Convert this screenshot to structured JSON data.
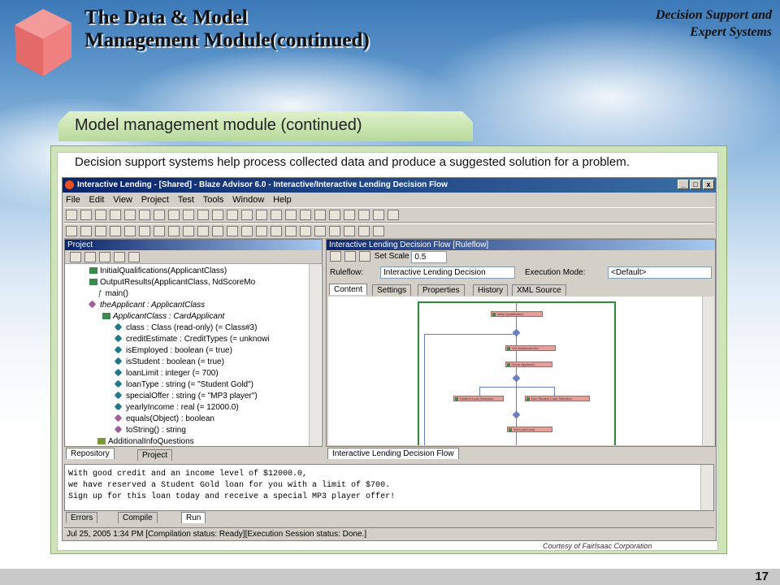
{
  "slide": {
    "title_line1": "The Data & Model",
    "title_line2": "Management Module(continued)",
    "brand_line1": "Decision Support and",
    "brand_line2": "Expert Systems",
    "ribbon_label": "Model management module (continued)",
    "caption": "Decision support systems help process collected data and produce a suggested solution for a problem.",
    "courtesy": "Courtesy of Fairlsaac Corporation",
    "page_number": "17"
  },
  "app": {
    "window_title": "Interactive Lending - [Shared] - Blaze Advisor 6.0 - Interactive/Interactive Lending Decision Flow",
    "window_controls": [
      "_",
      "□",
      "x"
    ],
    "menu": [
      "File",
      "Edit",
      "View",
      "Project",
      "Test",
      "Tools",
      "Window",
      "Help"
    ],
    "project_panel": {
      "header": "Project",
      "items": [
        "InitialQualifications(ApplicantClass)",
        "OutputResults(ApplicantClass, NdScoreMo",
        "main()",
        "theApplicant : ApplicantClass",
        "ApplicantClass : CardApplicant",
        "class : Class (read-only) (= Class#3)",
        "creditEstimate : CreditTypes  (= unknowi",
        "isEmployed : boolean  (= true)",
        "isStudent : boolean  (= true)",
        "loanLimit : integer  (= 700)",
        "loanType : string  (= \"Student Gold\")",
        "specialOffer : string  (= \"MP3 player\")",
        "yearlyIncome : real  (= 12000.0)",
        "equals(Object) : boolean",
        "toString() : string",
        "AdditionalInfoQuestions"
      ],
      "tabs": [
        "Repository",
        "Project"
      ]
    },
    "flow_panel": {
      "header": "Interactive Lending Decision Flow [Ruleflow]",
      "set_scale_label": "Set Scale",
      "scale_value": "0.5",
      "ruleflow_label": "Ruleflow:",
      "ruleflow_value": "Interactive Lending Decision",
      "execution_mode_label": "Execution Mode:",
      "execution_mode_value": "<Default>",
      "tabs": [
        "Content",
        "Settings",
        "Properties",
        "History",
        "XML Source"
      ],
      "bottom_tab": "Interactive Lending Decision Flow",
      "nodes": [
        "Initial Qualification",
        "Get Additional Info",
        "Score Applicant",
        "Student Loan Selection",
        "Non Student Loan Selection",
        "Set Loan Limit"
      ]
    },
    "console": {
      "lines": [
        "With good credit and an income level of $12000.0,",
        "we have reserved a Student Gold loan for you with a limit of $700.",
        "Sign up for this loan today and receive a special MP3 player offer!"
      ],
      "tabs": [
        "Errors",
        "Compile",
        "Run"
      ]
    },
    "status_bar": "Jul 25, 2005 1:34 PM [Compilation status: Ready][Execution Session status: Done.]"
  }
}
